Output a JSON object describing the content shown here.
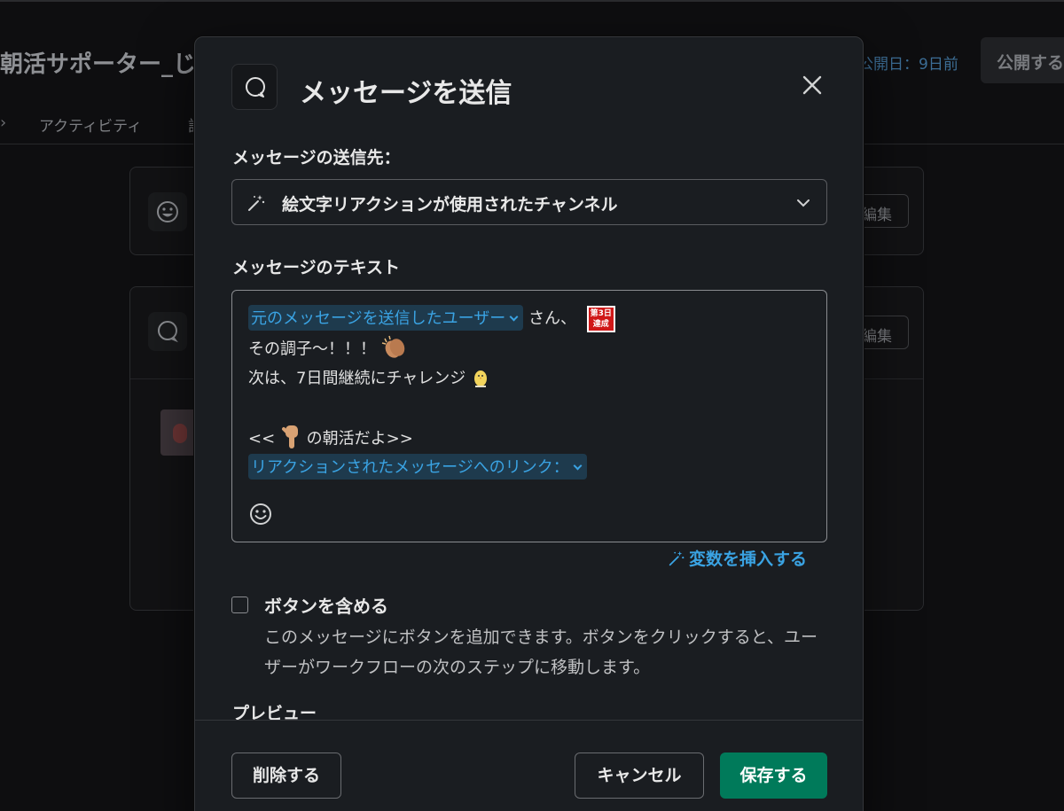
{
  "background": {
    "workflow_title": "朝活サポーター_じ",
    "published": "公開日：9日前",
    "publish_button": "公開する",
    "tab_arrow": "›",
    "tab_activity": "アクティビティ",
    "tab_other": "設",
    "edit_label": "編集"
  },
  "modal": {
    "title": "メッセージを送信",
    "icon": "message-bubble-icon",
    "recipient_label": "メッセージの送信先：",
    "recipient_value": "絵文字リアクションが使用されたチャンネル",
    "text_label": "メッセージのテキスト",
    "message": {
      "line1_variable": "元のメッセージを送信したユーザー",
      "line1_suffix": "さん、",
      "badge_top": "第3日",
      "badge_bottom": "達成",
      "line2": "その調子〜！！！",
      "line3": "次は、7日間継続にチャレンジ",
      "line5_prefix": "<<",
      "line5_suffix": "の朝活だよ>>",
      "line6_variable": "リアクションされたメッセージへのリンク："
    },
    "insert_variable": "変数を挿入する",
    "include_buttons_label": "ボタンを含める",
    "include_buttons_checked": false,
    "include_buttons_description": "このメッセージにボタンを追加できます。ボタンをクリックすると、ユーザーがワークフローの次のステップに移動します。",
    "preview_label": "プレビュー",
    "delete_button": "削除する",
    "cancel_button": "キャンセル",
    "save_button": "保存する"
  },
  "colors": {
    "accent_link": "#3aa3e3",
    "save_green": "#007a5a",
    "modal_bg": "#1a1d21"
  }
}
